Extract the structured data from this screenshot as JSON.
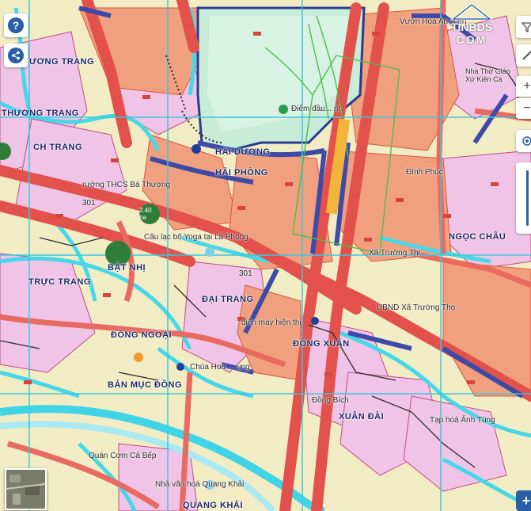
{
  "controls": {
    "help_label": "?",
    "share_icon": "share-icon",
    "filter_icon": "filter-icon",
    "zoom_in_label": "+",
    "zoom_out_label": "−",
    "locate_icon": "locate-icon",
    "layer_toggle_label": "+"
  },
  "watermark": {
    "line1": "TINBDS",
    "line2": "COM"
  },
  "labels": {
    "hai_duong": "HẢI DƯƠNG",
    "hai_phong": "HẢI PHÒNG",
    "ngoc_chu": "NGỌC CHÂU",
    "truong_trang_top": "ƯƠNG TRANG",
    "ich_trang": "CH TRANG",
    "truc_trang": "TRỰC TRANG",
    "dai_trang": "ĐẠI TRANG",
    "dong_ngoai": "ĐỒNG NGOẠI",
    "dong_xuan": "ĐÔNG XUÂN",
    "xuan_dai": "XUÂN ĐÀI",
    "quang_khai": "QUANG KHẢI",
    "road_301_left": "301",
    "road_301_center": "301",
    "dien_label": "Điểm đầu... nt",
    "xa_truong_thi": "Xã Trường Thị",
    "ubnd": "UBND Xã Trường Thọ",
    "dien_may": "điện máy hiện thị",
    "chua_hoa": "Chùa Hoa ... ung",
    "thcs": "rường THCS Bá Thượng",
    "yoga": "Câu lạc bộ Yoga tại Lã Phong",
    "ban_muc_dong": "BẢN MỤC ĐỒNG",
    "thuong_trang": "THƯƠNG TRANG",
    "yuan_hoa": "Vườn Hoa An Hiên",
    "nha_tho": "Nhà Thờ Giáo Xứ Kiên Cà",
    "dinh_phuc": "Đình Phúc",
    "tap_hoa": "Tạp hoá Ảnh Tùng",
    "bat_nhi": "BẬT NHỊ",
    "dong_bich": "Đồng Bích",
    "quan_com": "Quán Cơm Cả Bếp",
    "nha_van_hoa": "Nhà văn hoá Quang Khải"
  },
  "badges": {
    "b1": "2.40 ha",
    "b2": ""
  }
}
